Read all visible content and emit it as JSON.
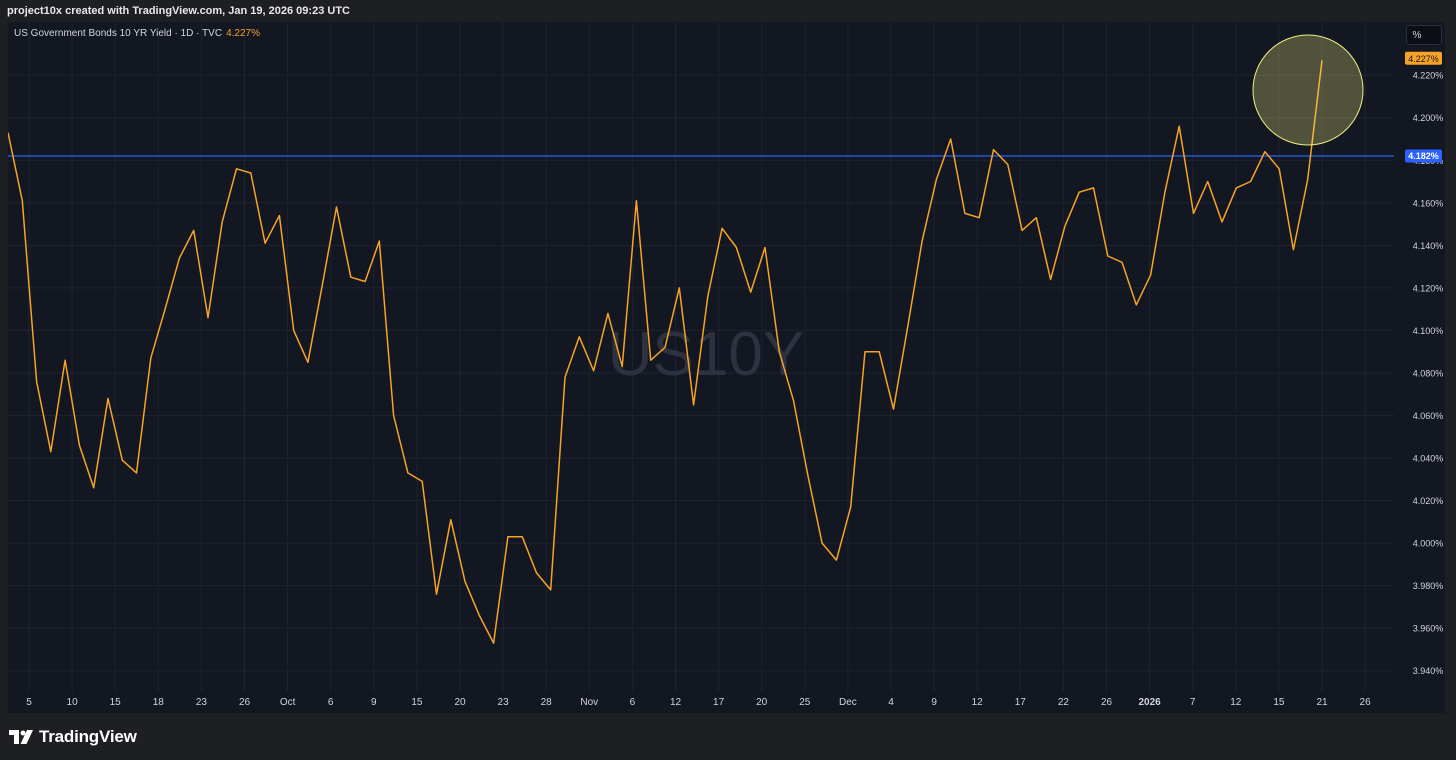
{
  "header": {
    "attribution": "project10x created with TradingView.com, Jan 19, 2026 09:23 UTC"
  },
  "legend": {
    "symbol_description": "US Government Bonds 10 YR Yield · 1D · TVC",
    "last_value": "4.227%"
  },
  "toolbar": {
    "unit_label": "%"
  },
  "watermark": "US10Y",
  "price_labels": {
    "last_price": "4.227%",
    "line_level": "4.182%"
  },
  "footer": {
    "brand": "TradingView",
    "logo_icon": "tradingview-logo-icon"
  },
  "colors": {
    "background": "#131722",
    "series": "#f7a325",
    "horizontal_line": "#2962ff",
    "highlight_circle": "#f2ee7d",
    "grid": "#1f2330"
  },
  "chart_data": {
    "type": "line",
    "title": "US Government Bonds 10 YR Yield · 1D · TVC",
    "xlabel": "",
    "ylabel": "",
    "ylim": [
      3.93,
      4.245
    ],
    "grid": true,
    "legend_placement": "top-left",
    "y_ticks": [
      "4.220%",
      "4.200%",
      "4.180%",
      "4.160%",
      "4.140%",
      "4.120%",
      "4.100%",
      "4.080%",
      "4.060%",
      "4.040%",
      "4.020%",
      "4.000%",
      "3.980%",
      "3.960%",
      "3.940%"
    ],
    "x_ticks": [
      "5",
      "10",
      "15",
      "18",
      "23",
      "26",
      "Oct",
      "6",
      "9",
      "15",
      "20",
      "23",
      "28",
      "Nov",
      "6",
      "12",
      "17",
      "20",
      "25",
      "Dec",
      "4",
      "9",
      "12",
      "17",
      "22",
      "26",
      "2026",
      "7",
      "12",
      "15",
      "21",
      "26"
    ],
    "x_ticks_bold": [
      "2026"
    ],
    "series": [
      {
        "name": "US10Y",
        "values": [
          4.193,
          4.161,
          4.076,
          4.043,
          4.086,
          4.046,
          4.026,
          4.068,
          4.039,
          4.033,
          4.087,
          4.11,
          4.134,
          4.147,
          4.106,
          4.151,
          4.176,
          4.174,
          4.141,
          4.154,
          4.1,
          4.085,
          4.121,
          4.158,
          4.125,
          4.123,
          4.142,
          4.06,
          4.033,
          4.029,
          3.976,
          4.011,
          3.982,
          3.966,
          3.953,
          4.003,
          4.003,
          3.986,
          3.978,
          4.078,
          4.097,
          4.081,
          4.108,
          4.083,
          4.161,
          4.086,
          4.092,
          4.12,
          4.065,
          4.116,
          4.148,
          4.139,
          4.118,
          4.139,
          4.09,
          4.067,
          4.032,
          4.0,
          3.992,
          4.017,
          4.09,
          4.09,
          4.063,
          4.102,
          4.142,
          4.171,
          4.19,
          4.155,
          4.153,
          4.185,
          4.178,
          4.147,
          4.153,
          4.124,
          4.149,
          4.165,
          4.167,
          4.135,
          4.132,
          4.112,
          4.126,
          4.165,
          4.196,
          4.155,
          4.17,
          4.151,
          4.167,
          4.17,
          4.184,
          4.176,
          4.138,
          4.171,
          4.227
        ]
      }
    ],
    "horizontal_line": 4.182,
    "annotation": "highlight circle around latest rise"
  }
}
